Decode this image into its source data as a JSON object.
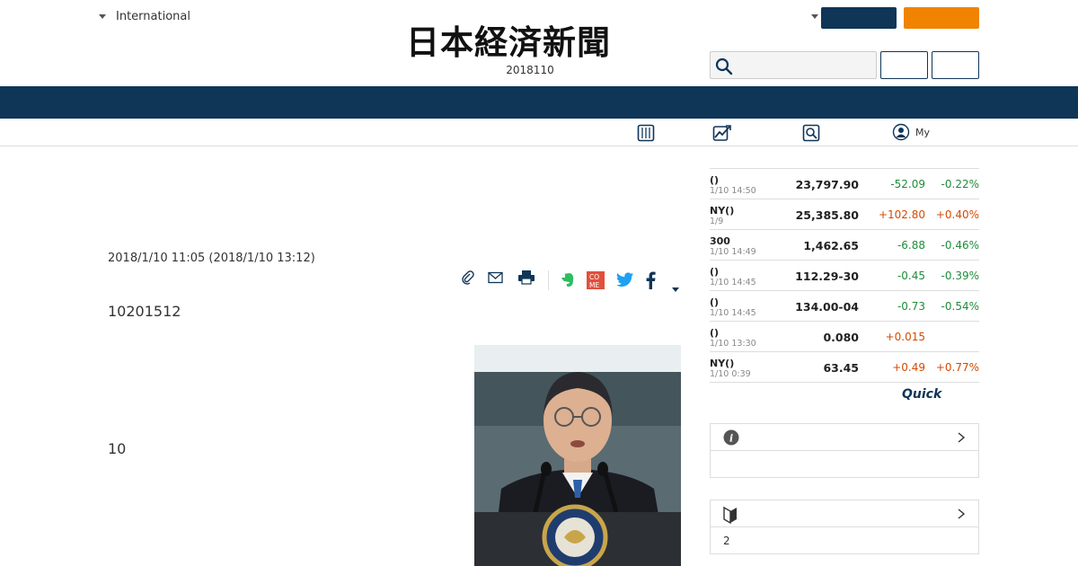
{
  "header": {
    "edition_label": "International",
    "logo_text": "日本経済新聞",
    "date": "2018110",
    "colors": {
      "navy": "#0f3557",
      "orange": "#f08300"
    }
  },
  "subnav": {
    "my_label": "My",
    "icons": [
      "newspaper-icon",
      "chart-icon",
      "search-box-icon",
      "user-icon"
    ]
  },
  "article": {
    "timestamp": "2018/1/10 11:05 (2018/1/10 13:12)",
    "lead": "10201512",
    "paragraph": "10",
    "tools": [
      "clip-icon",
      "mail-icon",
      "print-icon",
      "evernote-icon",
      "comment-icon",
      "twitter-icon",
      "facebook-icon",
      "more-caret-icon"
    ]
  },
  "market": {
    "rows": [
      {
        "name": "()",
        "time": "1/10 14:50",
        "value": "23,797.90",
        "change": "-52.09",
        "pct": "-0.22%",
        "dir": "neg"
      },
      {
        "name": "NY()",
        "time": "1/9",
        "value": "25,385.80",
        "change": "+102.80",
        "pct": "+0.40%",
        "dir": "pos"
      },
      {
        "name": "300",
        "time": "1/10 14:49",
        "value": "1,462.65",
        "change": "-6.88",
        "pct": "-0.46%",
        "dir": "neg"
      },
      {
        "name": "()",
        "time": "1/10 14:45",
        "value": "112.29-30",
        "change": "-0.45",
        "pct": "-0.39%",
        "dir": "neg"
      },
      {
        "name": "()",
        "time": "1/10 14:45",
        "value": "134.00-04",
        "change": "-0.73",
        "pct": "-0.54%",
        "dir": "neg"
      },
      {
        "name": "()",
        "time": "1/10 13:30",
        "value": "0.080",
        "change": "+0.015",
        "pct": "",
        "dir": "pos"
      },
      {
        "name": "NY()",
        "time": "1/10 0:39",
        "value": "63.45",
        "change": "+0.49",
        "pct": "+0.77%",
        "dir": "pos"
      }
    ],
    "source_logo": "Quick"
  },
  "sidebar": {
    "box1": {
      "icon": "info-icon",
      "body": ""
    },
    "box2": {
      "icon": "beginner-mark-icon",
      "body": "2"
    }
  }
}
